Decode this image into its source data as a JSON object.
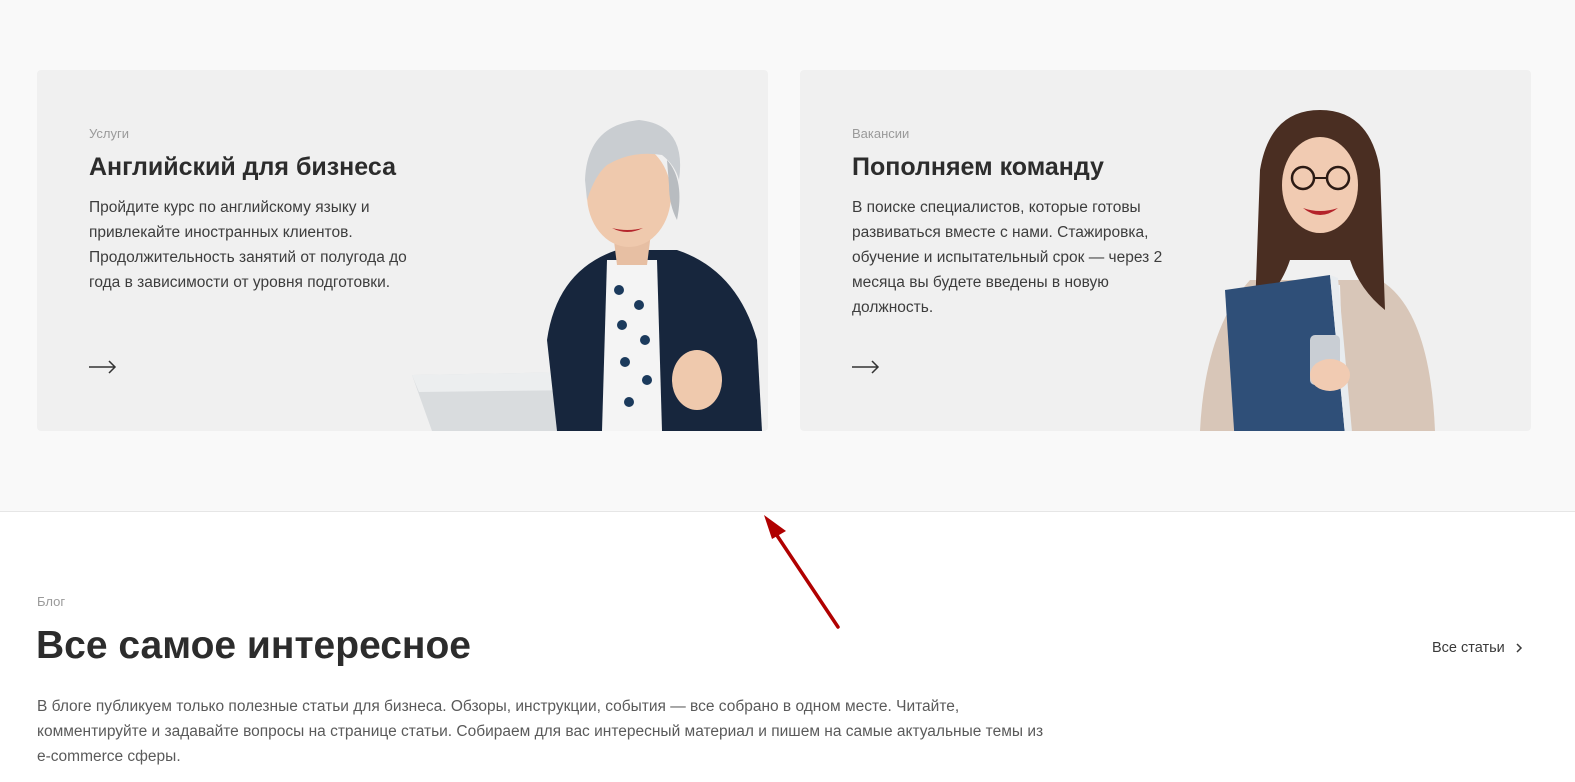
{
  "cards": [
    {
      "eyebrow": "Услуги",
      "title": "Английский для бизнеса",
      "description": "Пройдите курс по английскому языку и привлекайте иностранных клиентов. Продолжительность занятий от полугода до года в зависимости от уровня подготовки.",
      "arrow_icon": "arrow-right-icon"
    },
    {
      "eyebrow": "Вакансии",
      "title": "Пополняем команду",
      "description": "В поиске специалистов, которые готовы развиваться вместе с нами. Стажировка, обучение и испытательный срок — через 2 месяца вы будете введены в новую должность.",
      "arrow_icon": "arrow-right-icon"
    }
  ],
  "blog": {
    "eyebrow": "Блог",
    "title": "Все самое интересное",
    "description": "В блоге публикуем только полезные статьи для бизнеса. Обзоры, инструкции, события — все собрано в одном месте. Читайте, комментируйте и задавайте вопросы на странице статьи. Собираем для вас интересный материал и пишем на самые актуальные темы из e-commerce сферы.",
    "all_link_label": "Все статьи",
    "all_link_icon": "chevron-right-icon"
  },
  "colors": {
    "section_bg": "#f9f9f9",
    "card_bg": "#f0f0f0",
    "annotation_arrow": "#b00000"
  }
}
